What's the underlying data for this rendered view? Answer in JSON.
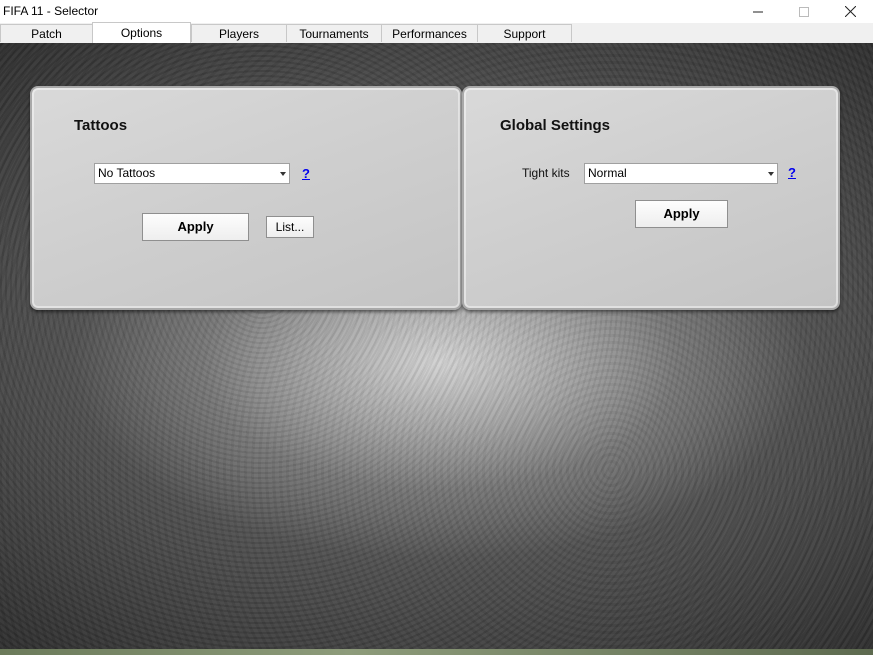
{
  "window": {
    "title": "FIFA 11 - Selector",
    "controls": {
      "minimize_icon": "minimize-icon",
      "maximize_icon": "maximize-icon",
      "close_icon": "close-icon"
    }
  },
  "tabs": [
    {
      "label": "Patch",
      "active": false
    },
    {
      "label": "Options",
      "active": true
    },
    {
      "label": "Players",
      "active": false
    },
    {
      "label": "Tournaments",
      "active": false
    },
    {
      "label": "Performances",
      "active": false
    },
    {
      "label": "Support",
      "active": false
    }
  ],
  "tattoos": {
    "title": "Tattoos",
    "combo_value": "No Tattoos",
    "help": "?",
    "apply_label": "Apply",
    "list_label": "List..."
  },
  "global_settings": {
    "title": "Global Settings",
    "tight_kits_label": "Tight kits",
    "tight_kits_value": "Normal",
    "help": "?",
    "apply_label": "Apply"
  },
  "colors": {
    "accent_link": "#0000ee",
    "panel_bg": "#d2d2d2"
  }
}
